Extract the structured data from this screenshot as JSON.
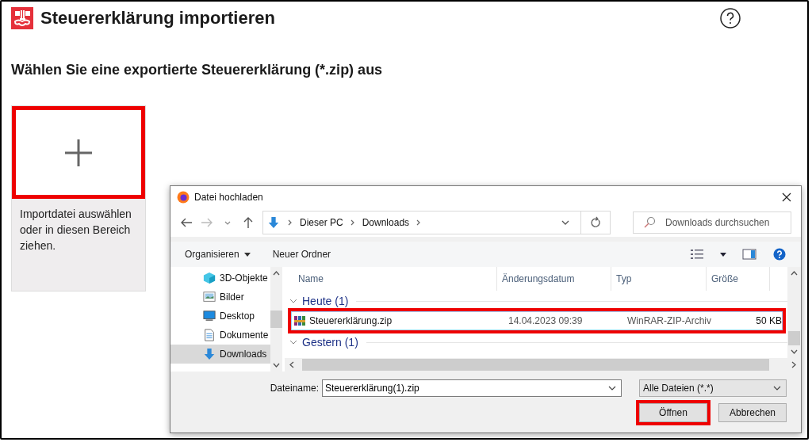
{
  "header": {
    "title": "Steuererklärung importieren"
  },
  "heading": "Wählen Sie eine exportierte Steuererklärung (*.zip) aus",
  "dropzone": {
    "highlighted": true,
    "text": "Importdatei auswählen oder in diesen Bereich ziehen."
  },
  "dialog": {
    "title": "Datei hochladen",
    "breadcrumb": [
      "Dieser PC",
      "Downloads"
    ],
    "search": {
      "placeholder": "Downloads durchsuchen"
    },
    "toolbar": [
      "Organisieren",
      "Neuer Ordner"
    ],
    "sidebar": [
      {
        "label": "3D-Objekte",
        "kind": "cube",
        "selected": false
      },
      {
        "label": "Bilder",
        "kind": "pictures",
        "selected": false
      },
      {
        "label": "Desktop",
        "kind": "monitor",
        "selected": false
      },
      {
        "label": "Dokumente",
        "kind": "document",
        "selected": false
      },
      {
        "label": "Downloads",
        "kind": "download",
        "selected": true
      }
    ],
    "columns": [
      "Name",
      "Änderungsdatum",
      "Typ",
      "Größe"
    ],
    "groups": [
      {
        "label": "Heute (1)",
        "files": [
          {
            "name": "Steuererklärung.zip",
            "date": "14.04.2023 09:39",
            "type": "WinRAR-ZIP-Archiv",
            "size": "50 KB",
            "highlighted": true
          }
        ]
      },
      {
        "label": "Gestern (1)"
      }
    ],
    "filename": {
      "label": "Dateiname:",
      "value": "Steuererklärung(1).zip"
    },
    "filter": "Alle Dateien (*.*)",
    "buttons": [
      {
        "label": "Öffnen",
        "highlighted": true
      },
      {
        "label": "Abbrechen",
        "highlighted": false
      }
    ]
  }
}
